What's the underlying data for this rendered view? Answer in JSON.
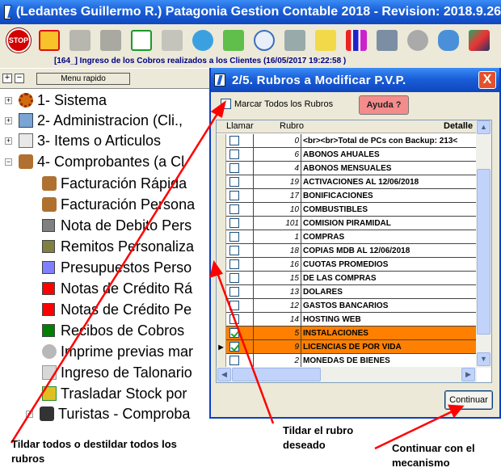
{
  "window": {
    "title": "(Ledantes Guillermo R.) Patagonia Gestion Contable 2018 - Revision: 2018.9.26"
  },
  "toolbar": {
    "stop_label": "STOP",
    "icons": [
      "stop-icon",
      "gift-icon",
      "user-grey-icon",
      "puzzle-icon",
      "download-arrow-icon",
      "tools-icon",
      "globe-icon",
      "person-icon",
      "clock-icon",
      "printer-icon",
      "tag-icon",
      "bar-chart-icon",
      "safe-icon",
      "circle-icon",
      "cloud-icon",
      "photo-icon"
    ]
  },
  "status_line": "[164_] Ingreso de los Cobros realizados a los Clientes (16/05/2017 19:22:58  )",
  "left_panel": {
    "plus": "+",
    "minus": "−",
    "menu_button": "Menu rapido",
    "tree": [
      {
        "label": "1- Sistema",
        "expander": "+",
        "icon": "gear-icon"
      },
      {
        "label": "2- Administracion (Cli.,",
        "expander": "+",
        "icon": "admin-icon"
      },
      {
        "label": "3- Items o Articulos",
        "expander": "+",
        "icon": "box-icon"
      },
      {
        "label": "4- Comprobantes (a Cl",
        "expander": "−",
        "icon": "bag-icon"
      },
      {
        "label": "Facturación Rápida",
        "icon": "bag-icon",
        "color": ""
      },
      {
        "label": "Facturación Persona",
        "icon": "bag-icon",
        "color": ""
      },
      {
        "label": "Nota de Debito Pers",
        "color": "#808080"
      },
      {
        "label": "Remitos Personaliza",
        "color": "#808040"
      },
      {
        "label": "Presupuestos Perso",
        "color": "#8080ff"
      },
      {
        "label": "Notas de Crédito Rá",
        "color": "#ff0000"
      },
      {
        "label": "Notas de Crédito Pe",
        "color": "#ff0000"
      },
      {
        "label": "Recibos de Cobros",
        "color": "#008000"
      },
      {
        "label": "Imprime previas mar",
        "icon": "print-icon"
      },
      {
        "label": "Ingreso de Talonario",
        "icon": "book-icon"
      },
      {
        "label": "Trasladar Stock por",
        "icon": "truck-icon"
      },
      {
        "label": "Turistas - Comproba",
        "expander": "+",
        "icon": "camera-icon"
      }
    ]
  },
  "dialog": {
    "title": "2/5. Rubros a Modificar P.V.P.",
    "close": "X",
    "select_all_label": "Marcar Todos los Rubros",
    "help_button": "Ayuda ?",
    "columns": {
      "check": "Llamar",
      "code": "Rubro",
      "detail": "Detalle"
    },
    "rows": [
      {
        "checked": false,
        "code": "0",
        "detail": "<br><br>Total de PCs con Backup: 213<",
        "selected": false,
        "current": false
      },
      {
        "checked": false,
        "code": "6",
        "detail": "ABONOS AHUALES",
        "selected": false,
        "current": false
      },
      {
        "checked": false,
        "code": "4",
        "detail": "ABONOS MENSUALES",
        "selected": false,
        "current": false
      },
      {
        "checked": false,
        "code": "19",
        "detail": "ACTIVACIONES AL 12/06/2018",
        "selected": false,
        "current": false
      },
      {
        "checked": false,
        "code": "17",
        "detail": "BONIFICACIONES",
        "selected": false,
        "current": false
      },
      {
        "checked": false,
        "code": "10",
        "detail": "COMBUSTIBLES",
        "selected": false,
        "current": false
      },
      {
        "checked": false,
        "code": "101",
        "detail": "COMISION PIRAMIDAL",
        "selected": false,
        "current": false
      },
      {
        "checked": false,
        "code": "1",
        "detail": "COMPRAS",
        "selected": false,
        "current": false
      },
      {
        "checked": false,
        "code": "18",
        "detail": "COPIAS MDB AL 12/06/2018",
        "selected": false,
        "current": false
      },
      {
        "checked": false,
        "code": "16",
        "detail": "CUOTAS PROMEDIOS",
        "selected": false,
        "current": false
      },
      {
        "checked": false,
        "code": "15",
        "detail": "DE LAS COMPRAS",
        "selected": false,
        "current": false
      },
      {
        "checked": false,
        "code": "13",
        "detail": "DOLARES",
        "selected": false,
        "current": false
      },
      {
        "checked": false,
        "code": "12",
        "detail": "GASTOS BANCARIOS",
        "selected": false,
        "current": false
      },
      {
        "checked": false,
        "code": "14",
        "detail": "HOSTING WEB",
        "selected": false,
        "current": false
      },
      {
        "checked": true,
        "code": "5",
        "detail": "INSTALACIONES",
        "selected": true,
        "current": false
      },
      {
        "checked": true,
        "code": "9",
        "detail": "LICENCIAS DE POR VIDA",
        "selected": true,
        "current": true
      },
      {
        "checked": false,
        "code": "2",
        "detail": "MONEDAS DE BIENES",
        "selected": false,
        "current": false
      }
    ],
    "continue_button": "Continuar",
    "selected_color": "#ff8000"
  },
  "annotations": {
    "select_all": "Tildar todos o destildar todos los rubros",
    "select_one": "Tildar el rubro deseado",
    "continue": "Continuar con el mecanismo",
    "arrow_color": "#ff0000"
  }
}
